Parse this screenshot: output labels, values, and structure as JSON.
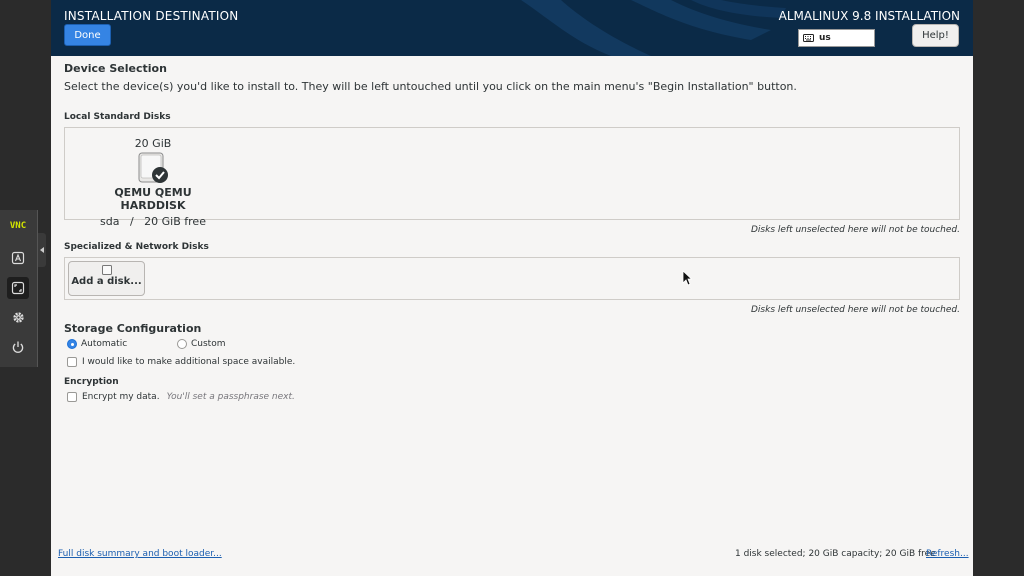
{
  "header": {
    "title": "INSTALLATION DESTINATION",
    "done_label": "Done",
    "product": "ALMALINUX 9.8 INSTALLATION",
    "keyboard_layout": "us",
    "help_label": "Help!"
  },
  "device_selection": {
    "heading": "Device Selection",
    "description": "Select the device(s) you'd like to install to.  They will be left untouched until you click on the main menu's \"Begin Installation\" button."
  },
  "local_disks": {
    "heading": "Local Standard Disks",
    "disks": [
      {
        "size": "20 GiB",
        "name": "QEMU QEMU HARDDISK",
        "details": "sda   /   20 GiB free",
        "selected": true
      }
    ],
    "hint": "Disks left unselected here will not be touched."
  },
  "network_disks": {
    "heading": "Specialized & Network Disks",
    "add_label": "Add a disk...",
    "hint": "Disks left unselected here will not be touched."
  },
  "storage_config": {
    "heading": "Storage Configuration",
    "automatic_label": "Automatic",
    "custom_label": "Custom",
    "selected": "Automatic",
    "space_label": "I would like to make additional space available.",
    "space_checked": false
  },
  "encryption": {
    "heading": "Encryption",
    "encrypt_label": "Encrypt my data.",
    "encrypt_note": "You'll set a passphrase next.",
    "encrypt_checked": false
  },
  "footer": {
    "summary_link": "Full disk summary and boot loader...",
    "status": "1 disk selected; 20 GiB capacity; 20 GiB free",
    "refresh_link": "Refresh..."
  },
  "vnc_toolbar": {
    "logo": "VNC",
    "items": [
      "keyboard-icon",
      "fullscreen-icon",
      "settings-gear-icon",
      "power-icon"
    ]
  },
  "colors": {
    "header_bg": "#0b2a47",
    "accent": "#3584e4",
    "content_bg": "#f6f5f4",
    "link": "#1c5fb0",
    "vnc_logo": "#d4e600"
  }
}
